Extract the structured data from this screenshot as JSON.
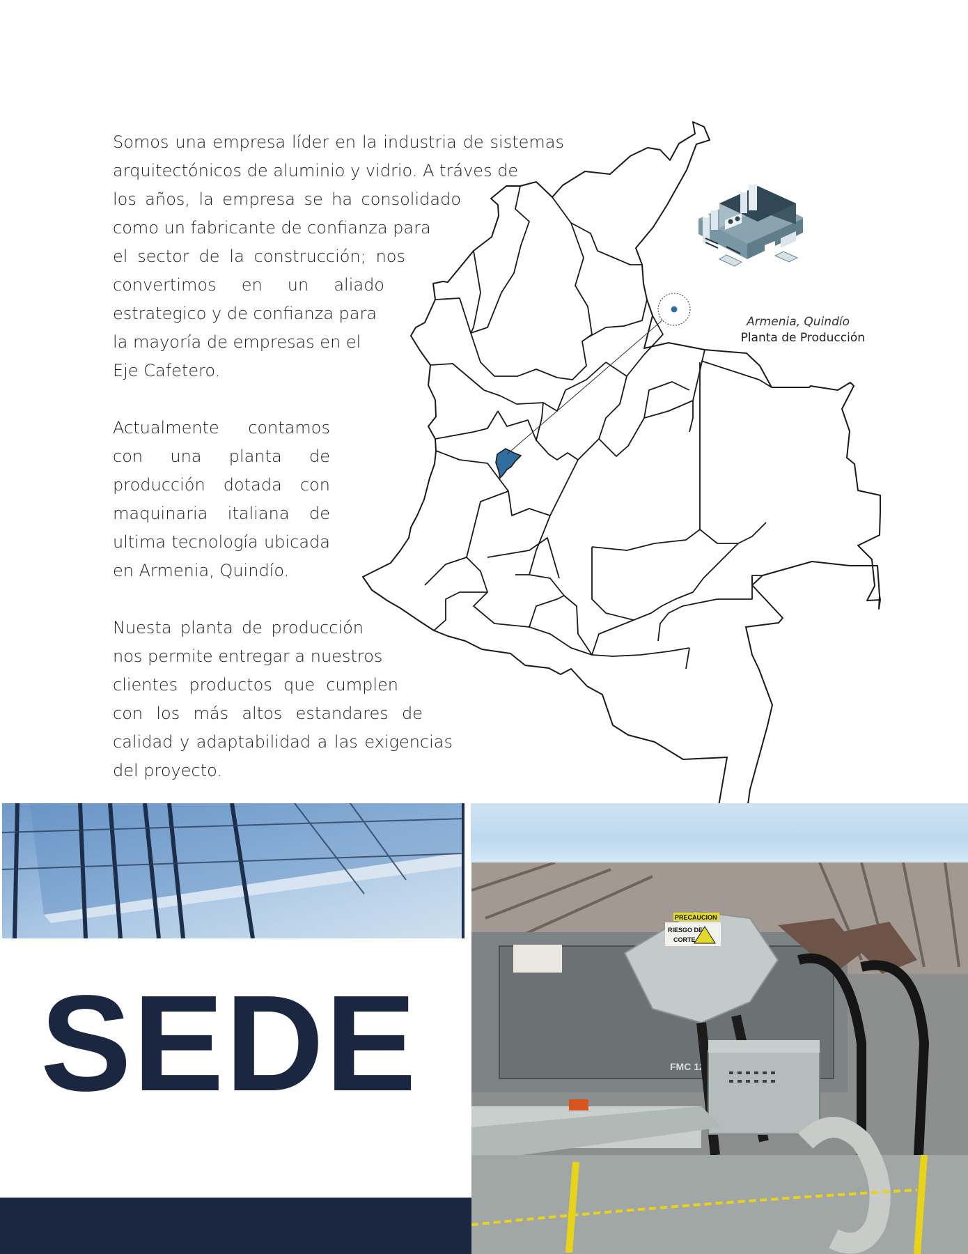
{
  "intro": {
    "paragraphs": [
      [
        "Somos una empresa líder en la industria de sistemas",
        "arquitectónicos de aluminio y vidrio. A tráves de",
        "los años, la empresa se ha consolidado",
        "como un fabricante de confianza para",
        "el sector de la construcción; nos",
        "convertimos en un aliado",
        "estrategico y de confianza para",
        "la mayoría de empresas en el",
        "Eje Cafetero."
      ],
      [
        "Actualmente contamos",
        "con una planta de",
        "producción dotada con",
        "maquinaria italiana de",
        "ultima tecnología ubicada",
        "en Armenia, Quindío."
      ],
      [
        "Nuesta planta de producción",
        "nos permite entregar a nuestros",
        "clientes productos que cumplen",
        "con los más altos estandares de",
        "calidad y adaptabilidad a las exigencias",
        "del proyecto."
      ]
    ]
  },
  "map": {
    "location_city": "Armenia, Quindío",
    "location_label": "Planta de Producción",
    "highlight_color": "#2f6e9e",
    "outline_color": "#1a1a1a"
  },
  "machine_sign": {
    "warning": "PRECAUCION",
    "line1": "RIESGO DE",
    "line2": "CORTE",
    "model": "FMC 12"
  },
  "title": "SEDE",
  "colors": {
    "navy": "#1b2640",
    "sky": "#bcd8ee"
  }
}
